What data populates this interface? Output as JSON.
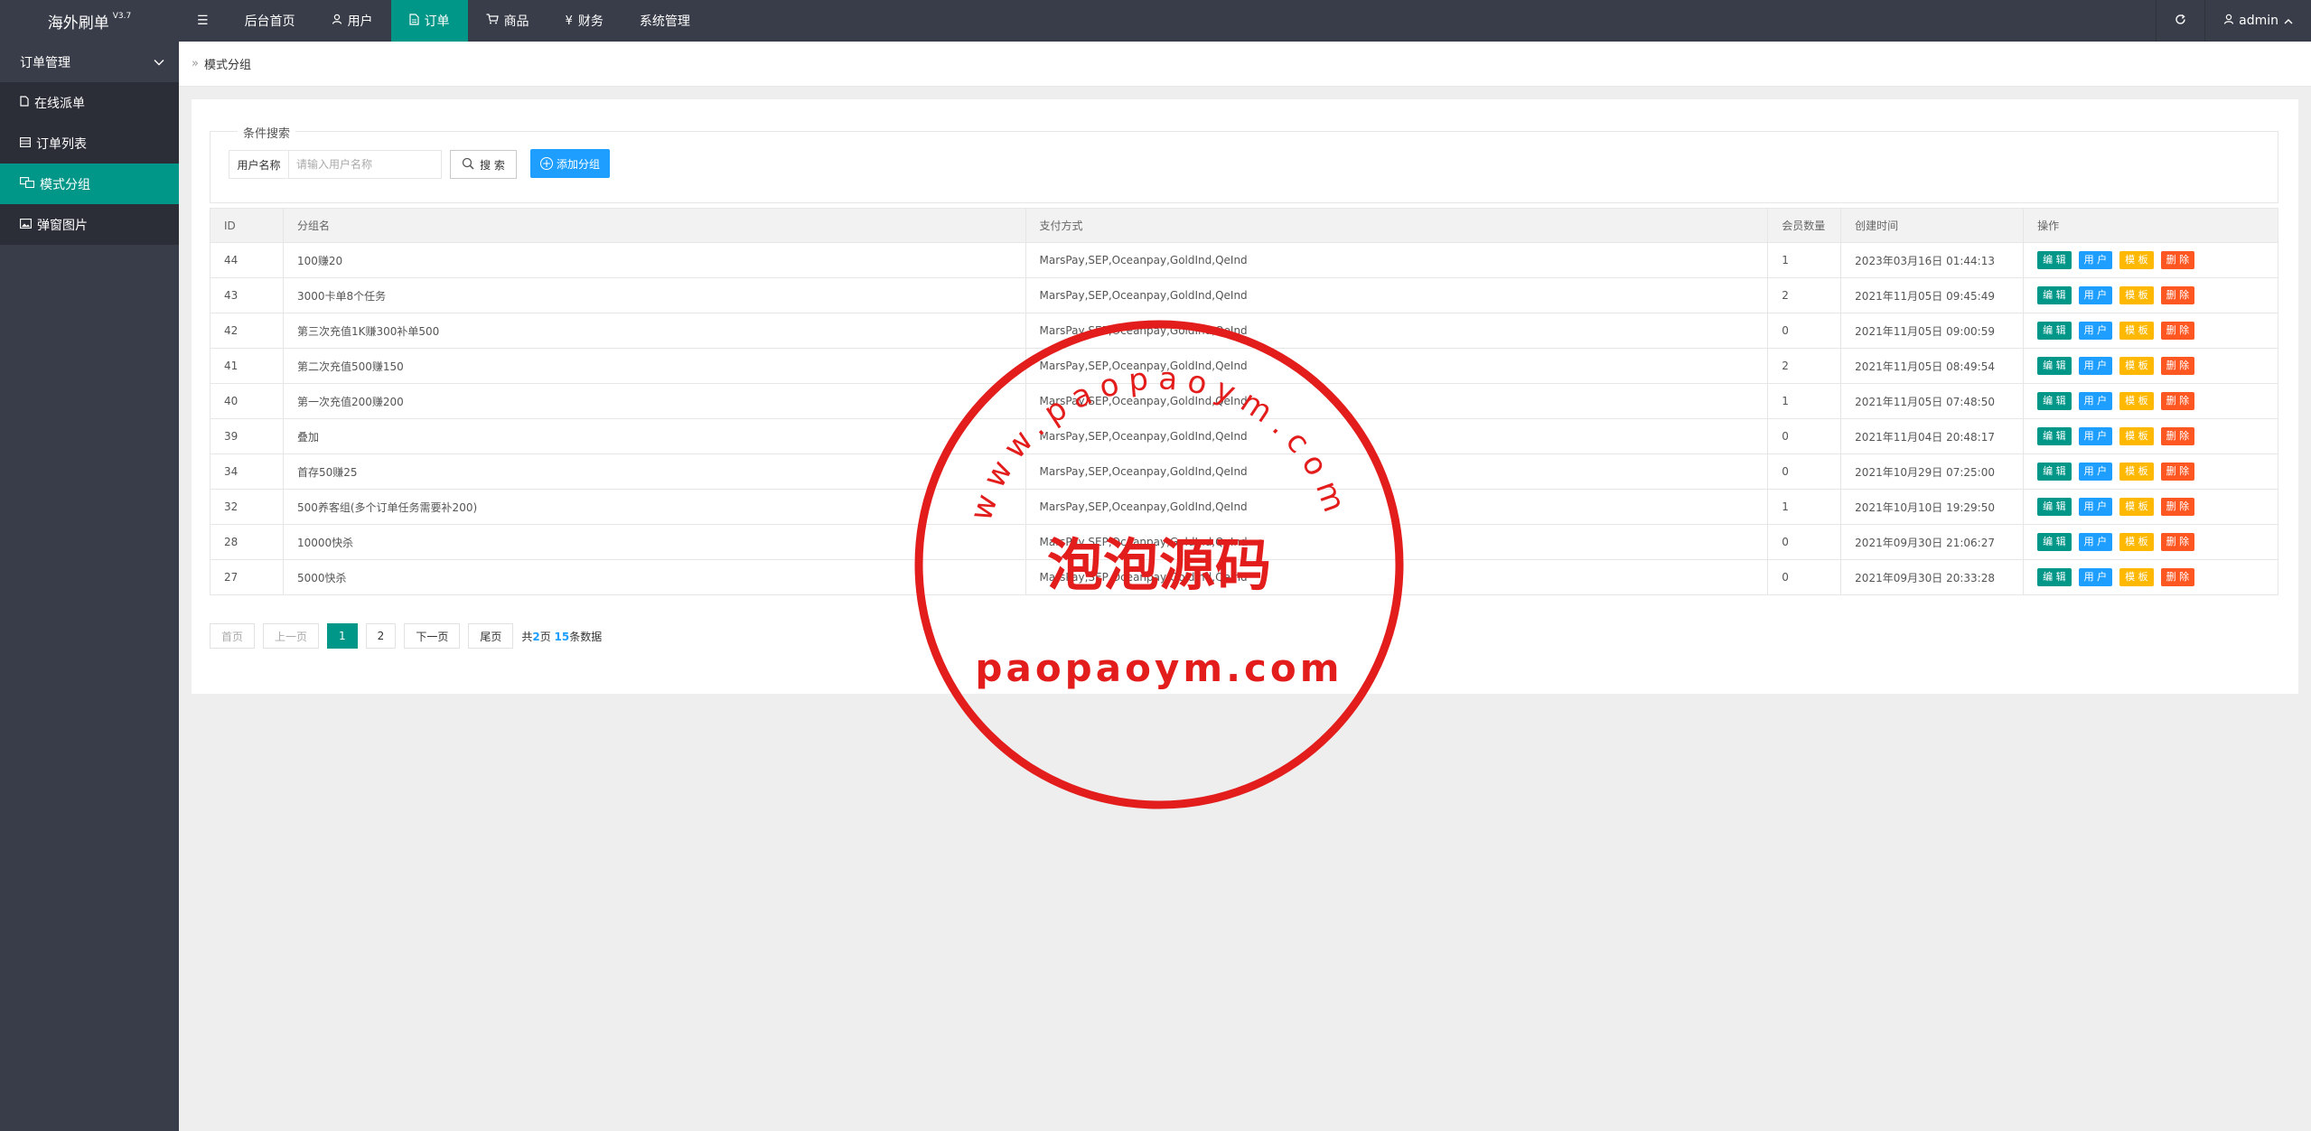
{
  "app": {
    "title": "海外刷单",
    "version": "V3.7"
  },
  "topnav": {
    "menu_icon": "☰",
    "items": [
      {
        "label": "后台首页",
        "icon": ""
      },
      {
        "label": "用户",
        "icon": "user-icon"
      },
      {
        "label": "订单",
        "icon": "file-icon"
      },
      {
        "label": "商品",
        "icon": "cart-icon"
      },
      {
        "label": "财务",
        "icon": "yen-icon"
      },
      {
        "label": "系统管理",
        "icon": ""
      }
    ],
    "refresh_icon": "refresh-icon",
    "user": "admin"
  },
  "sidebar": {
    "group": "订单管理",
    "items": [
      {
        "label": "在线派单",
        "icon": "doc-icon"
      },
      {
        "label": "订单列表",
        "icon": "list-icon"
      },
      {
        "label": "模式分组",
        "icon": "group-icon"
      },
      {
        "label": "弹窗图片",
        "icon": "image-icon"
      }
    ]
  },
  "breadcrumb": {
    "current": "模式分组"
  },
  "filter": {
    "legend": "条件搜索",
    "username_label": "用户名称",
    "username_placeholder": "请输入用户名称",
    "search_label": "搜 索",
    "add_label": "添加分组"
  },
  "table": {
    "headers": [
      "ID",
      "分组名",
      "支付方式",
      "会员数量",
      "创建时间",
      "操作"
    ],
    "rows": [
      {
        "id": "44",
        "name": "100赚20",
        "pay": "MarsPay,SEP,Oceanpay,GoldInd,QeInd",
        "count": "1",
        "time": "2023年03月16日 01:44:13"
      },
      {
        "id": "43",
        "name": "3000卡单8个任务",
        "pay": "MarsPay,SEP,Oceanpay,GoldInd,QeInd",
        "count": "2",
        "time": "2021年11月05日 09:45:49"
      },
      {
        "id": "42",
        "name": "第三次充值1K赚300补单500",
        "pay": "MarsPay,SEP,Oceanpay,GoldInd,QeInd",
        "count": "0",
        "time": "2021年11月05日 09:00:59"
      },
      {
        "id": "41",
        "name": "第二次充值500赚150",
        "pay": "MarsPay,SEP,Oceanpay,GoldInd,QeInd",
        "count": "2",
        "time": "2021年11月05日 08:49:54"
      },
      {
        "id": "40",
        "name": "第一次充值200赚200",
        "pay": "MarsPay,SEP,Oceanpay,GoldInd,QeInd",
        "count": "1",
        "time": "2021年11月05日 07:48:50"
      },
      {
        "id": "39",
        "name": "叠加",
        "pay": "MarsPay,SEP,Oceanpay,GoldInd,QeInd",
        "count": "0",
        "time": "2021年11月04日 20:48:17"
      },
      {
        "id": "34",
        "name": "首存50赚25",
        "pay": "MarsPay,SEP,Oceanpay,GoldInd,QeInd",
        "count": "0",
        "time": "2021年10月29日 07:25:00"
      },
      {
        "id": "32",
        "name": "500养客组(多个订单任务需要补200)",
        "pay": "MarsPay,SEP,Oceanpay,GoldInd,QeInd",
        "count": "1",
        "time": "2021年10月10日 19:29:50"
      },
      {
        "id": "28",
        "name": "10000快杀",
        "pay": "MarsPay,SEP,Oceanpay,GoldInd,QeInd",
        "count": "0",
        "time": "2021年09月30日 21:06:27"
      },
      {
        "id": "27",
        "name": "5000快杀",
        "pay": "MarsPay,SEP,Oceanpay,GoldInd,QeInd",
        "count": "0",
        "time": "2021年09月30日 20:33:28"
      }
    ],
    "actions": {
      "edit": "编 辑",
      "user": "用 户",
      "template": "模 板",
      "delete": "删 除"
    }
  },
  "pager": {
    "first": "首页",
    "prev": "上一页",
    "pages": [
      "1",
      "2"
    ],
    "current": "1",
    "next": "下一页",
    "last": "尾页",
    "info_prefix": "共",
    "total_pages": "2",
    "info_mid": "页 ",
    "total_rows": "15",
    "info_suffix": "条数据"
  },
  "watermark": {
    "arc_text": "www.paopaoym.com",
    "center_text": "泡泡源码",
    "bottom_text": "paopaoym.com",
    "color": "#e31c1c"
  },
  "colors": {
    "primary": "#009688",
    "blue": "#1e9fff",
    "yellow": "#ffb800",
    "red": "#ff5722",
    "dark": "#393d49"
  }
}
